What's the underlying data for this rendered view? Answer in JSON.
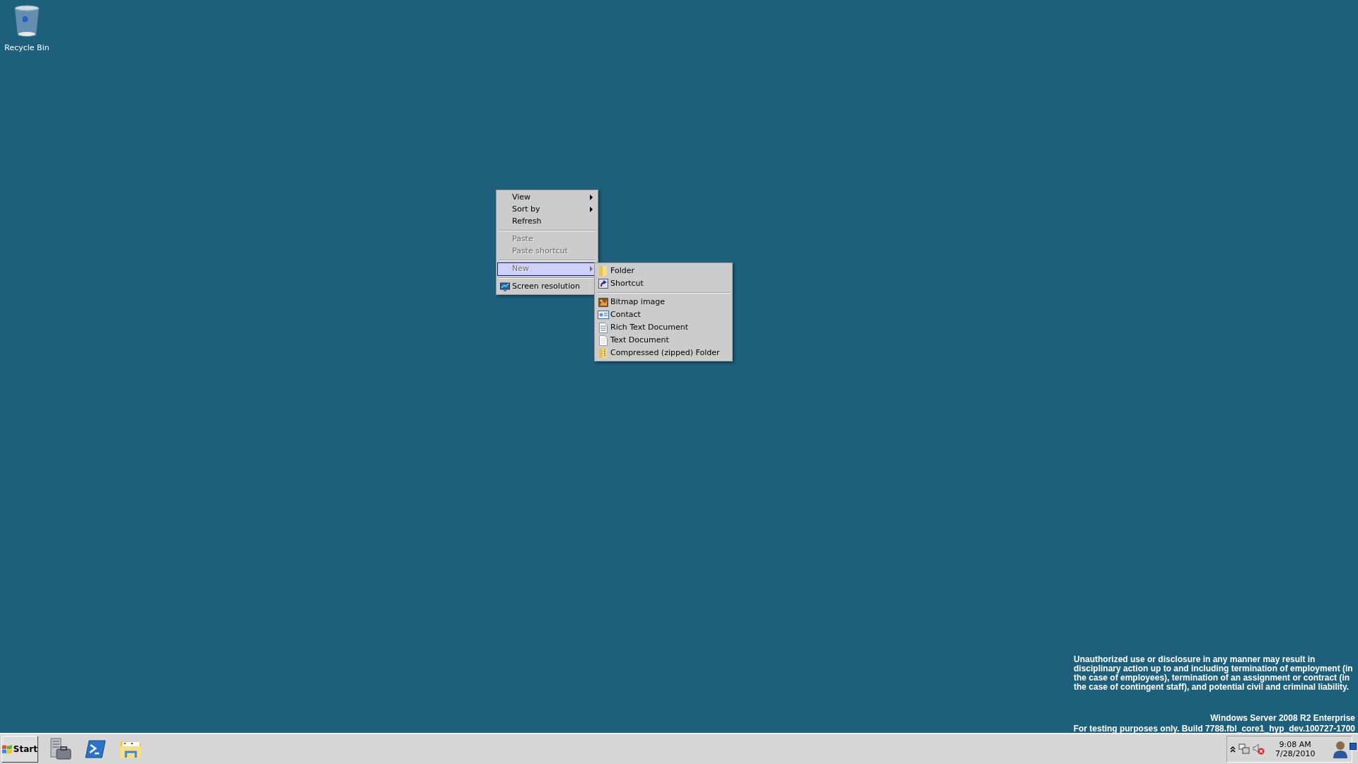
{
  "desktop_icons": [
    {
      "label": "Recycle Bin"
    }
  ],
  "context_menu": {
    "items": [
      {
        "kind": "item",
        "label": "View",
        "disabled": false,
        "submenu": true,
        "selected": false
      },
      {
        "kind": "item",
        "label": "Sort by",
        "disabled": false,
        "submenu": true,
        "selected": false
      },
      {
        "kind": "item",
        "label": "Refresh",
        "disabled": false,
        "submenu": false,
        "selected": false
      },
      {
        "kind": "separator"
      },
      {
        "kind": "item",
        "label": "Paste",
        "disabled": true,
        "submenu": false,
        "selected": false
      },
      {
        "kind": "item",
        "label": "Paste shortcut",
        "disabled": true,
        "submenu": false,
        "selected": false
      },
      {
        "kind": "separator"
      },
      {
        "kind": "item",
        "label": "New",
        "disabled": true,
        "submenu": true,
        "selected": true
      },
      {
        "kind": "separator"
      },
      {
        "kind": "monitor",
        "label": "Screen resolution",
        "disabled": false,
        "submenu": false,
        "selected": false
      }
    ]
  },
  "submenu": {
    "items": [
      {
        "kind": "folder",
        "label": "Folder"
      },
      {
        "kind": "shortcut",
        "label": "Shortcut"
      },
      {
        "kind": "separator"
      },
      {
        "kind": "bitmap",
        "label": "Bitmap image"
      },
      {
        "kind": "contact",
        "label": "Contact"
      },
      {
        "kind": "richtext",
        "label": "Rich Text Document"
      },
      {
        "kind": "text",
        "label": "Text Document"
      },
      {
        "kind": "zip",
        "label": "Compressed (zipped) Folder"
      }
    ]
  },
  "notice": {
    "text": "Unauthorized use or disclosure in any manner may result in disciplinary action up to and including termination of employment (in the case of employees), termination of an assignment or contract (in the case of contingent staff), and potential civil and criminal liability.",
    "edition": "Windows Server 2008 R2 Enterprise",
    "build": "For testing purposes only. Build 7788.fbl_core1_hyp_dev.100727-1700"
  },
  "taskbar": {
    "start_label": "Start",
    "pinned": [
      {
        "kind": "server"
      },
      {
        "kind": "powershell"
      },
      {
        "kind": "explorer"
      }
    ],
    "time": "9:08 AM",
    "date": "7/28/2010"
  }
}
